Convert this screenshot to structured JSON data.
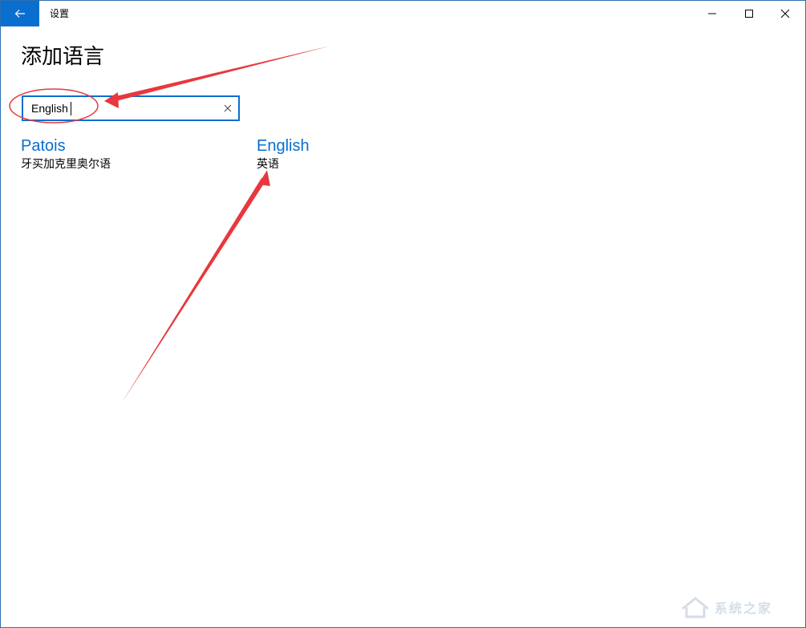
{
  "titlebar": {
    "app_title": "设置",
    "back_icon": "back-arrow-icon",
    "minimize_icon": "minimize-icon",
    "maximize_icon": "maximize-icon",
    "close_icon": "close-icon"
  },
  "page": {
    "title": "添加语言"
  },
  "search": {
    "value": "English",
    "clear_icon": "clear-icon"
  },
  "results": [
    {
      "name": "Patois",
      "native_name": "牙买加克里奥尔语"
    },
    {
      "name": "English",
      "native_name": "英语"
    }
  ],
  "watermark": {
    "text": "系统之家"
  },
  "colors": {
    "accent": "#0a6ecf",
    "annotation": "#e8383d"
  }
}
